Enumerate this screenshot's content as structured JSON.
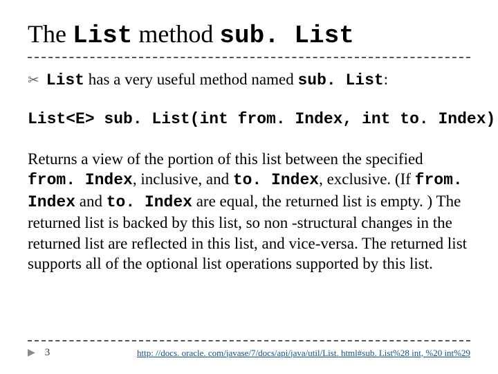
{
  "title": {
    "pre": "The ",
    "code1": "List",
    "mid": " method ",
    "code2": "sub. List"
  },
  "bullet": {
    "code1": "List",
    "text1": " has a very useful method named ",
    "code2": "sub. List",
    "text2": ":"
  },
  "signature": "List<E> sub. List(int from. Index, int to. Index)",
  "desc": {
    "p1a": "Returns a view of the portion of this list between the specified ",
    "c1": "from. Index",
    "p1b": ", inclusive, and ",
    "c2": "to. Index",
    "p1c": ", exclusive. (If ",
    "c3": "from. Index",
    "p1d": " and ",
    "c4": "to. Index",
    "p1e": " are equal, the returned list is empty. ) The returned list is backed by this list, so non -structural changes in the returned list are reflected in this list, and vice-versa. The returned list supports all of the optional list operations supported by this list."
  },
  "footer": {
    "page": "3",
    "link": "http: //docs. oracle. com/javase/7/docs/api/java/util/List. html#sub. List%28 int, %20 int%29"
  }
}
